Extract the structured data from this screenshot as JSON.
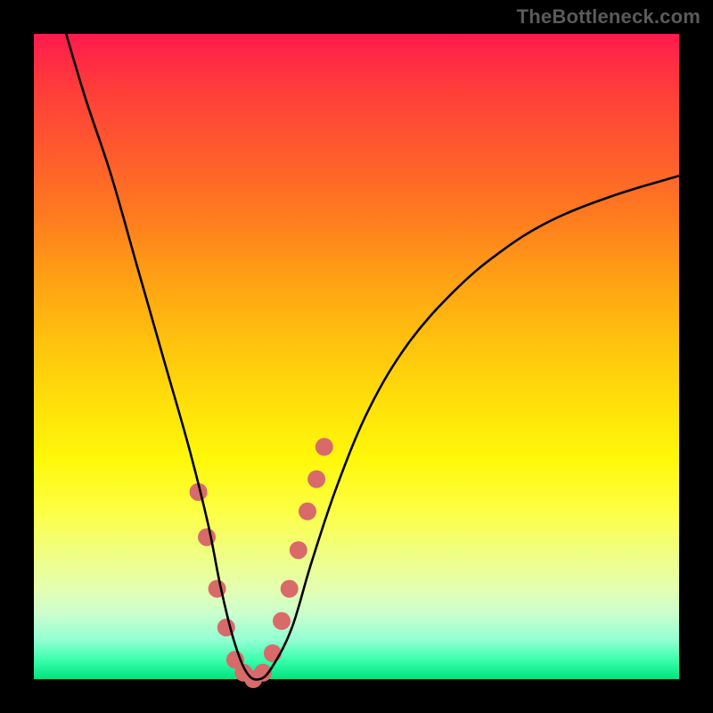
{
  "watermark_text": "TheBottleneck.com",
  "chart_data": {
    "type": "line",
    "title": "",
    "xlabel": "",
    "ylabel": "",
    "x_range": [
      0,
      100
    ],
    "y_range": [
      0,
      100
    ],
    "series": [
      {
        "name": "bottleneck-curve",
        "x": [
          5,
          8,
          12,
          16,
          20,
          24,
          27,
          29,
          31,
          33,
          35,
          37,
          40,
          43,
          47,
          52,
          58,
          65,
          72,
          80,
          90,
          100
        ],
        "y": [
          100,
          90,
          78,
          64,
          50,
          36,
          24,
          14,
          6,
          1,
          0,
          2,
          8,
          18,
          30,
          42,
          52,
          60,
          66,
          71,
          75,
          78
        ]
      }
    ],
    "markers": {
      "name": "highlighted-points",
      "color": "#d96a6a",
      "x": [
        25.5,
        26.8,
        28.4,
        29.8,
        31.2,
        32.5,
        34.0,
        35.5,
        37.0,
        38.4,
        39.6,
        41.0,
        42.4,
        43.8,
        45.0
      ],
      "y": [
        29,
        22,
        14,
        8,
        3,
        1,
        0,
        1,
        4,
        9,
        14,
        20,
        26,
        31,
        36
      ],
      "radius": 10
    },
    "gradient_stops": [
      {
        "pos": 0.0,
        "color": "#ff1a4d"
      },
      {
        "pos": 0.5,
        "color": "#ffd400"
      },
      {
        "pos": 0.78,
        "color": "#ffff55"
      },
      {
        "pos": 1.0,
        "color": "#00e37e"
      }
    ]
  }
}
